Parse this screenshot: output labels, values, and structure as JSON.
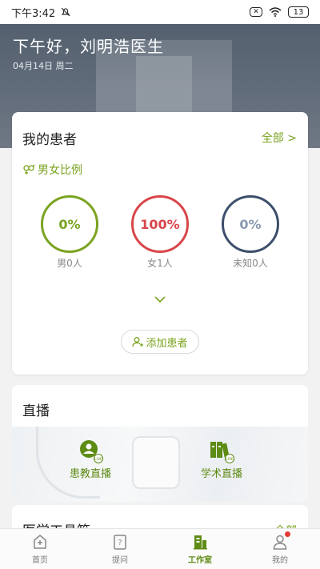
{
  "status_bar": {
    "time": "下午3:42",
    "battery": "13"
  },
  "header": {
    "greeting": "下午好，刘明浩医生",
    "date": "04月14日 周二"
  },
  "patients": {
    "title": "我的患者",
    "all_link": "全部 >",
    "ratio_title": "男女比例",
    "stats": [
      {
        "percent": "0%",
        "label": "男0人",
        "color": "#7aa31f"
      },
      {
        "percent": "100%",
        "label": "女1人",
        "color": "#d8464a"
      },
      {
        "percent": "0%",
        "label": "未知0人",
        "color": "#3c4f6b"
      }
    ],
    "add_button": "添加患者"
  },
  "live": {
    "title": "直播",
    "items": [
      {
        "label": "患教直播",
        "icon": "patient-education-live-icon"
      },
      {
        "label": "学术直播",
        "icon": "academic-live-icon"
      }
    ]
  },
  "tools": {
    "title": "医学工具箱",
    "all_link": "全部"
  },
  "bottom_nav": {
    "items": [
      {
        "label": "首页",
        "icon": "home-icon",
        "active": false
      },
      {
        "label": "提问",
        "icon": "question-icon",
        "active": false
      },
      {
        "label": "工作室",
        "icon": "studio-icon",
        "active": true
      },
      {
        "label": "我的",
        "icon": "profile-icon",
        "active": false,
        "badge": true
      }
    ]
  },
  "colors": {
    "accent": "#7aa31f",
    "female": "#d8464a",
    "unknown": "#3c4f6b"
  }
}
